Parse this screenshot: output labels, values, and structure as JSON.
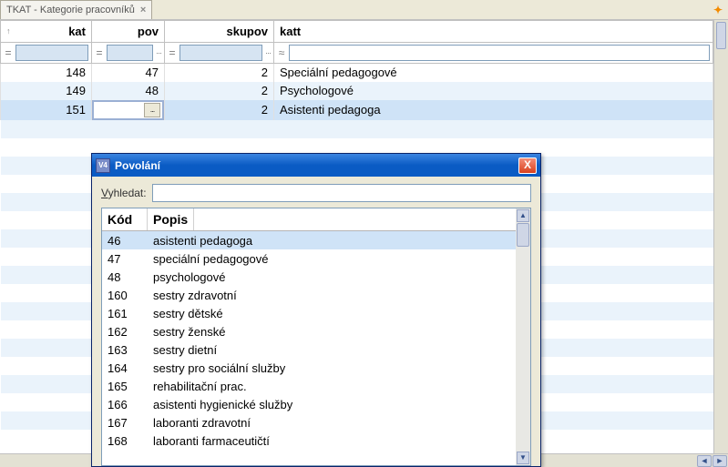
{
  "tab": {
    "title": "TKAT - Kategorie pracovníků",
    "close_glyph": "×"
  },
  "grid": {
    "headers": {
      "kat": "kat",
      "pov": "pov",
      "skupov": "skupov",
      "katt": "katt"
    },
    "filter_ops": {
      "eq": "=",
      "approx": "≈",
      "more": "···"
    },
    "sort_indicator": "↑",
    "rows": [
      {
        "kat": "148",
        "pov": "47",
        "skupov": "2",
        "katt": "Speciální pedagogové"
      },
      {
        "kat": "149",
        "pov": "48",
        "skupov": "2",
        "katt": "Psychologové"
      },
      {
        "kat": "151",
        "pov": "",
        "skupov": "2",
        "katt": "Asistenti pedagoga",
        "editing": true
      }
    ],
    "edit_btn": "..."
  },
  "dialog": {
    "icon": "V4",
    "title": "Povolání",
    "close_glyph": "X",
    "search_label_pre": "V",
    "search_label_rest": "yhledat:",
    "columns": {
      "kod": "Kód",
      "popis": "Popis"
    },
    "items": [
      {
        "kod": "46",
        "popis": "asistenti pedagoga",
        "selected": true
      },
      {
        "kod": "47",
        "popis": "speciální pedagogové"
      },
      {
        "kod": "48",
        "popis": "psychologové"
      },
      {
        "kod": "160",
        "popis": "sestry zdravotní"
      },
      {
        "kod": "161",
        "popis": "sestry dětské"
      },
      {
        "kod": "162",
        "popis": "sestry ženské"
      },
      {
        "kod": "163",
        "popis": "sestry dietní"
      },
      {
        "kod": "164",
        "popis": "sestry pro sociální služby"
      },
      {
        "kod": "165",
        "popis": "rehabilitační prac."
      },
      {
        "kod": "166",
        "popis": "asistenti hygienické služby"
      },
      {
        "kod": "167",
        "popis": "laboranti zdravotní"
      },
      {
        "kod": "168",
        "popis": "laboranti farmaceutičtí"
      }
    ],
    "scroll": {
      "up": "▲",
      "down": "▼"
    }
  },
  "glyphs": {
    "pin": "✦",
    "left": "◄",
    "right": "►",
    "up": "▲",
    "down": "▼"
  }
}
